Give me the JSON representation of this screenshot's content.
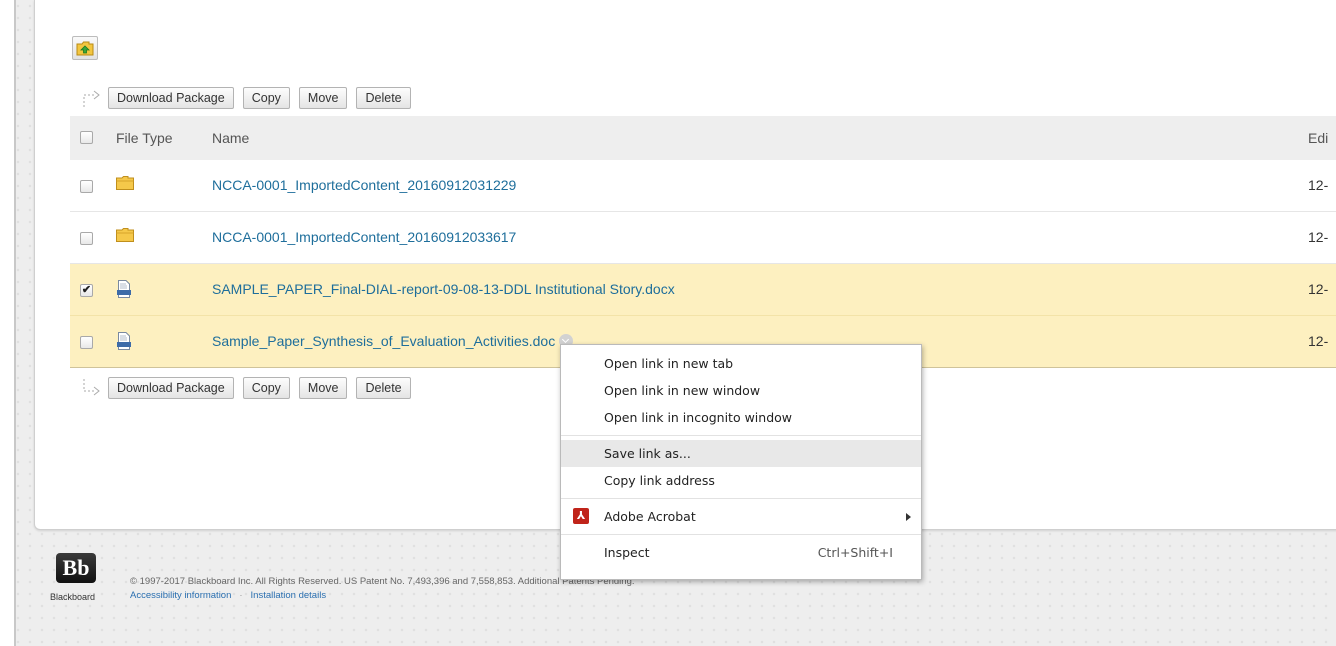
{
  "toolbar": {
    "up_folder_icon": "folder-up-icon",
    "actions": [
      "Download Package",
      "Copy",
      "Move",
      "Delete"
    ]
  },
  "table": {
    "headers": {
      "file_type": "File Type",
      "name": "Name",
      "edited": "Edi"
    },
    "rows": [
      {
        "type": "folder",
        "name": "NCCA-0001_ImportedContent_20160912031229",
        "edited": "12-",
        "checked": false
      },
      {
        "type": "folder",
        "name": "NCCA-0001_ImportedContent_20160912033617",
        "edited": "12-",
        "checked": false
      },
      {
        "type": "doc",
        "name": "SAMPLE_PAPER_Final-DIAL-report-09-08-13-DDL Institutional Story.docx",
        "edited": "12-",
        "checked": true
      },
      {
        "type": "doc",
        "name": "Sample_Paper_Synthesis_of_Evaluation_Activities.doc",
        "edited": "12-",
        "checked": false
      }
    ]
  },
  "context_menu": {
    "items": [
      "Open link in new tab",
      "Open link in new window",
      "Open link in incognito window",
      "Save link as...",
      "Copy link address",
      "Adobe Acrobat",
      "Inspect"
    ],
    "inspect_shortcut": "Ctrl+Shift+I",
    "highlighted": "Save link as..."
  },
  "footer": {
    "logo_text": "Bb",
    "brand": "Blackboard",
    "copyright": "© 1997-2017 Blackboard Inc. All Rights Reserved. US Patent No. 7,493,396 and 7,558,853. Additional Patents Pending.",
    "links": [
      "Accessibility information",
      "Installation details"
    ]
  },
  "colors": {
    "link": "#1e6e9b",
    "selected_row": "#fdf0c0",
    "acrobat_red": "#c0241a"
  }
}
